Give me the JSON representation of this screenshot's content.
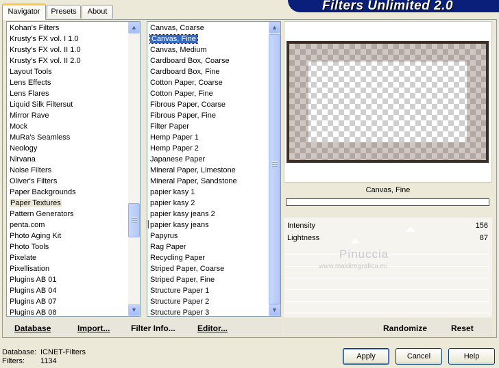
{
  "title": "Filters Unlimited 2.0",
  "tabs": [
    {
      "label": "Navigator"
    },
    {
      "label": "Presets"
    },
    {
      "label": "About"
    }
  ],
  "categories": {
    "items": [
      "Kohan's Filters",
      "Krusty's FX vol. I 1.0",
      "Krusty's FX vol. II 1.0",
      "Krusty's FX vol. II 2.0",
      "Layout Tools",
      "Lens Effects",
      "Lens Flares",
      "Liquid Silk Filtersut",
      "Mirror Rave",
      "Mock",
      "MuRa's Seamless",
      "Neology",
      "Nirvana",
      "Noise Filters",
      "Oliver's Filters",
      "Paper Backgrounds",
      "Paper Textures",
      "Pattern Generators",
      "penta.com",
      "Photo Aging Kit",
      "Photo Tools",
      "Pixelate",
      "Pixellisation",
      "Plugins AB 01",
      "Plugins AB 04",
      "Plugins AB 07",
      "Plugins AB 08"
    ],
    "selected": "Paper Textures"
  },
  "filters": {
    "items": [
      "Canvas, Coarse",
      "Canvas, Fine",
      "Canvas, Medium",
      "Cardboard Box, Coarse",
      "Cardboard Box, Fine",
      "Cotton Paper, Coarse",
      "Cotton Paper, Fine",
      "Fibrous Paper, Coarse",
      "Fibrous Paper, Fine",
      "Filter Paper",
      "Hemp Paper 1",
      "Hemp Paper 2",
      "Japanese Paper",
      "Mineral Paper, Limestone",
      "Mineral Paper, Sandstone",
      "papier kasy 1",
      "papier kasy 2",
      "papier kasy jeans 2",
      "papier kasy jeans",
      "Papyrus",
      "Rag Paper",
      "Recycling Paper",
      "Striped Paper, Coarse",
      "Striped Paper, Fine",
      "Structure Paper 1",
      "Structure Paper 2",
      "Structure Paper 3"
    ],
    "selected": "Canvas, Fine"
  },
  "preview": {
    "filter_name": "Canvas, Fine",
    "watermark_name": "Pinuccia",
    "watermark_url": "www.maidiregrafica.eu"
  },
  "parameters": [
    {
      "label": "Intensity",
      "value": "156"
    },
    {
      "label": "Lightness",
      "value": "87"
    }
  ],
  "bottom_links": {
    "database": "Database",
    "import": "Import...",
    "filter_info": "Filter Info...",
    "editor": "Editor...",
    "randomize": "Randomize",
    "reset": "Reset"
  },
  "status": {
    "database_label": "Database:",
    "database_value": "ICNET-Filters",
    "filters_label": "Filters:",
    "filters_value": "1134"
  },
  "buttons": {
    "apply": "Apply",
    "cancel": "Cancel",
    "help": "Help"
  },
  "colors": {
    "banner": "#0a1f7a",
    "selection": "#316ac5",
    "dialog": "#ece9d8"
  }
}
